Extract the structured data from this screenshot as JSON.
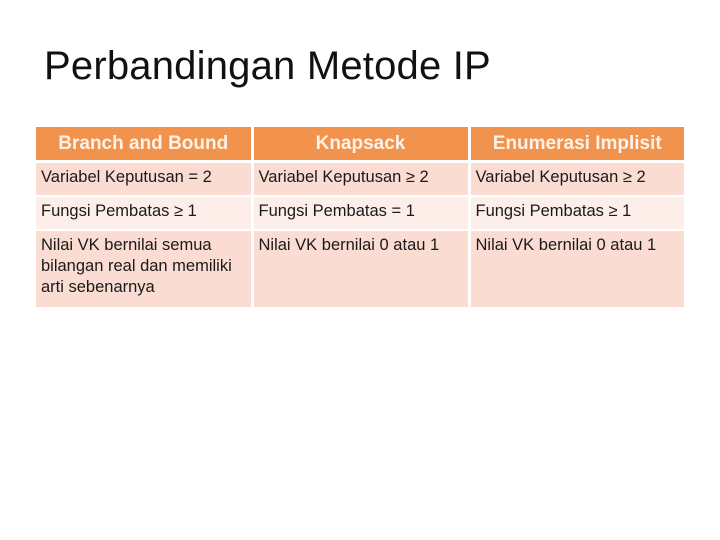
{
  "slide": {
    "title": "Perbandingan Metode IP"
  },
  "table": {
    "headers": [
      "Branch and Bound",
      "Knapsack",
      "Enumerasi Implisit"
    ],
    "rows": [
      [
        "Variabel Keputusan = 2",
        "Variabel Keputusan ≥ 2",
        "Variabel Keputusan ≥ 2"
      ],
      [
        "Fungsi Pembatas ≥ 1",
        "Fungsi Pembatas = 1",
        "Fungsi Pembatas ≥ 1"
      ],
      [
        "Nilai VK bernilai semua bilangan real dan memiliki arti sebenarnya",
        "Nilai VK bernilai 0 atau 1",
        "Nilai VK bernilai 0 atau 1"
      ]
    ],
    "colors": {
      "header_bg": "#f1924d",
      "row_odd_bg": "#fbdcd2",
      "row_even_bg": "#fdeeea"
    }
  }
}
